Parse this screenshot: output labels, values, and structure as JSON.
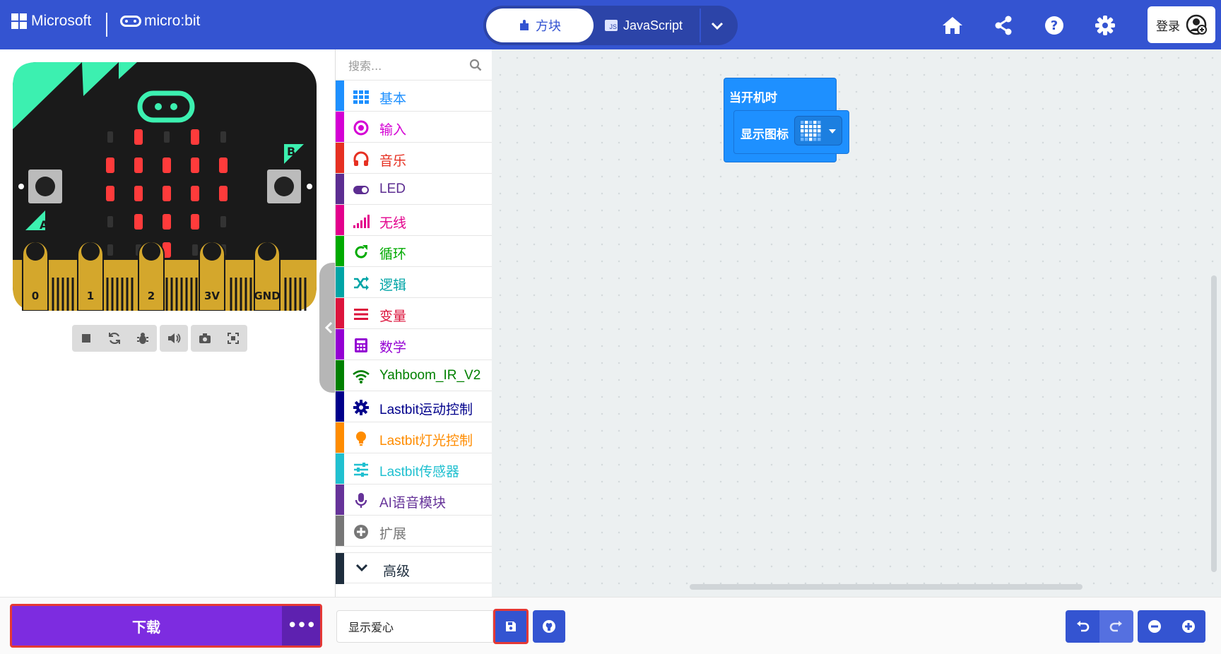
{
  "header": {
    "microsoft_label": "Microsoft",
    "microbit_label": "micro:bit",
    "mode_blocks": "方块",
    "mode_js": "JavaScript",
    "js_badge": "JS",
    "login_label": "登录"
  },
  "colors": {
    "header_bg": "#3454d1",
    "download_bg": "#7d2ce0",
    "block_blue": "#1e90ff",
    "led_red": "#ff3b3b"
  },
  "simulator": {
    "pin_labels": [
      "0",
      "1",
      "2",
      "3V",
      "GND"
    ],
    "button_a": "A",
    "button_b": "B",
    "tools": [
      "stop-icon",
      "restart-icon",
      "debug-icon",
      "mute-icon",
      "screenshot-icon",
      "fullscreen-icon"
    ]
  },
  "toolbox": {
    "search_placeholder": "搜索...",
    "categories": [
      {
        "label": "基本",
        "color": "#1e90ff",
        "icon": "grid-icon"
      },
      {
        "label": "输入",
        "color": "#d400d4",
        "icon": "input-circle-icon"
      },
      {
        "label": "音乐",
        "color": "#e63022",
        "icon": "headphones-icon"
      },
      {
        "label": "LED",
        "color": "#5c2d91",
        "icon": "toggle-icon"
      },
      {
        "label": "无线",
        "color": "#e3008c",
        "icon": "signal-bars-icon"
      },
      {
        "label": "循环",
        "color": "#00aa00",
        "icon": "loop-arrow-icon"
      },
      {
        "label": "逻辑",
        "color": "#00a4a6",
        "icon": "shuffle-icon"
      },
      {
        "label": "变量",
        "color": "#dc143c",
        "icon": "list-lines-icon"
      },
      {
        "label": "数学",
        "color": "#9400d3",
        "icon": "calculator-icon"
      },
      {
        "label": "Yahboom_IR_V2",
        "color": "#008000",
        "icon": "wifi-icon"
      },
      {
        "label": "Lastbit运动控制",
        "color": "#00008b",
        "icon": "gear-icon"
      },
      {
        "label": "Lastbit灯光控制",
        "color": "#ff8c00",
        "icon": "lightbulb-icon"
      },
      {
        "label": "Lastbit传感器",
        "color": "#20c0d0",
        "icon": "sliders-icon"
      },
      {
        "label": "AI语音模块",
        "color": "#663399",
        "icon": "microphone-icon"
      },
      {
        "label": "扩展",
        "color": "#777777",
        "icon": "plus-circle-icon"
      }
    ],
    "advanced_label": "高级"
  },
  "workspace": {
    "on_start_label": "当开机时",
    "show_icon_label": "显示图标"
  },
  "footer": {
    "download_label": "下载",
    "more_label": "•••",
    "project_name": "显示爱心"
  }
}
